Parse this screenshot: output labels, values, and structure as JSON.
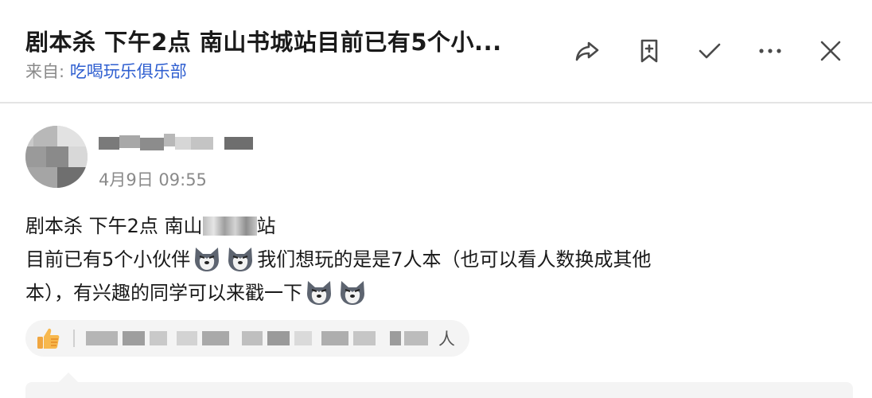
{
  "header": {
    "title": "剧本杀 下午2点 南山书城站目前已有5个小...",
    "from_label": "来自:",
    "from_link": "吃喝玩乐俱乐部"
  },
  "toolbar": {
    "share": "share-icon",
    "bookmark": "bookmark-add-icon",
    "done": "check-icon",
    "more": "more-icon",
    "close": "close-icon"
  },
  "post": {
    "time": "4月9日 09:55",
    "line1_a": "剧本杀 下午2点 南山",
    "line1_b": "站",
    "line2_a": "目前已有5个小伙伴",
    "line2_b": "我们想玩的是是7人本（也可以看人数换成其他",
    "line3": "本），有兴趣的同学可以来戳一下"
  },
  "likes": {
    "count_text": "人"
  },
  "colors": {
    "link": "#2f5fd0",
    "secondary_text": "#8a8a8a",
    "divider": "#e4e4e4",
    "pill_bg": "#f4f4f4"
  }
}
